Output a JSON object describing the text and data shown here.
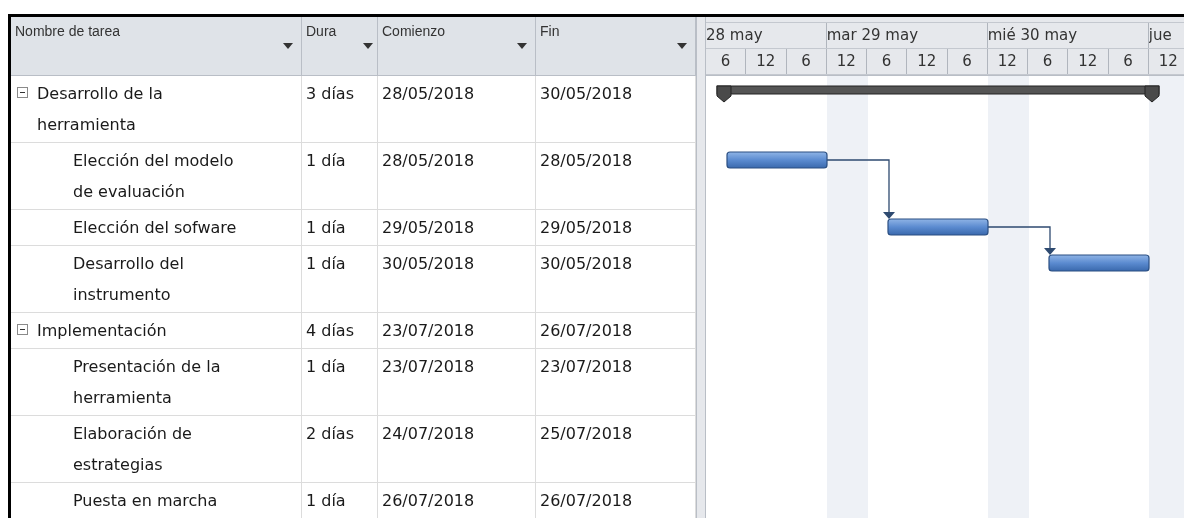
{
  "columns": [
    {
      "label": "Nombre de tarea"
    },
    {
      "label": "Dura"
    },
    {
      "label": "Comienzo"
    },
    {
      "label": "Fin"
    }
  ],
  "timescale": {
    "days": [
      "28 may",
      "mar 29 may",
      "mié 30 may",
      "jue"
    ],
    "hours": [
      "6",
      "12",
      "6",
      "12",
      "6",
      "12",
      "6",
      "12",
      "6",
      "12",
      "6",
      "12"
    ]
  },
  "tasks": [
    {
      "kind": "summary",
      "expanded": true,
      "name": "Desarrollo de la herramienta",
      "duration": "3 días",
      "start": "28/05/2018",
      "finish": "30/05/2018",
      "children": [
        {
          "kind": "task",
          "name": "Elección del modelo de evaluación",
          "duration": "1 día",
          "start": "28/05/2018",
          "finish": "28/05/2018"
        },
        {
          "kind": "task",
          "name": "Elección del sofware",
          "duration": "1 día",
          "start": "29/05/2018",
          "finish": "29/05/2018"
        },
        {
          "kind": "task",
          "name": "Desarrollo del instrumento",
          "duration": "1 día",
          "start": "30/05/2018",
          "finish": "30/05/2018"
        }
      ]
    },
    {
      "kind": "summary",
      "expanded": true,
      "name": "Implementación",
      "duration": "4 días",
      "start": "23/07/2018",
      "finish": "26/07/2018",
      "children": [
        {
          "kind": "task",
          "name": "Presentación de la herramienta",
          "duration": "1 día",
          "start": "23/07/2018",
          "finish": "23/07/2018"
        },
        {
          "kind": "task",
          "name": "Elaboración de estrategias",
          "duration": "2 días",
          "start": "24/07/2018",
          "finish": "25/07/2018"
        },
        {
          "kind": "task",
          "name": "Puesta en marcha",
          "duration": "1 día",
          "start": "26/07/2018",
          "finish": "26/07/2018"
        }
      ]
    }
  ]
}
